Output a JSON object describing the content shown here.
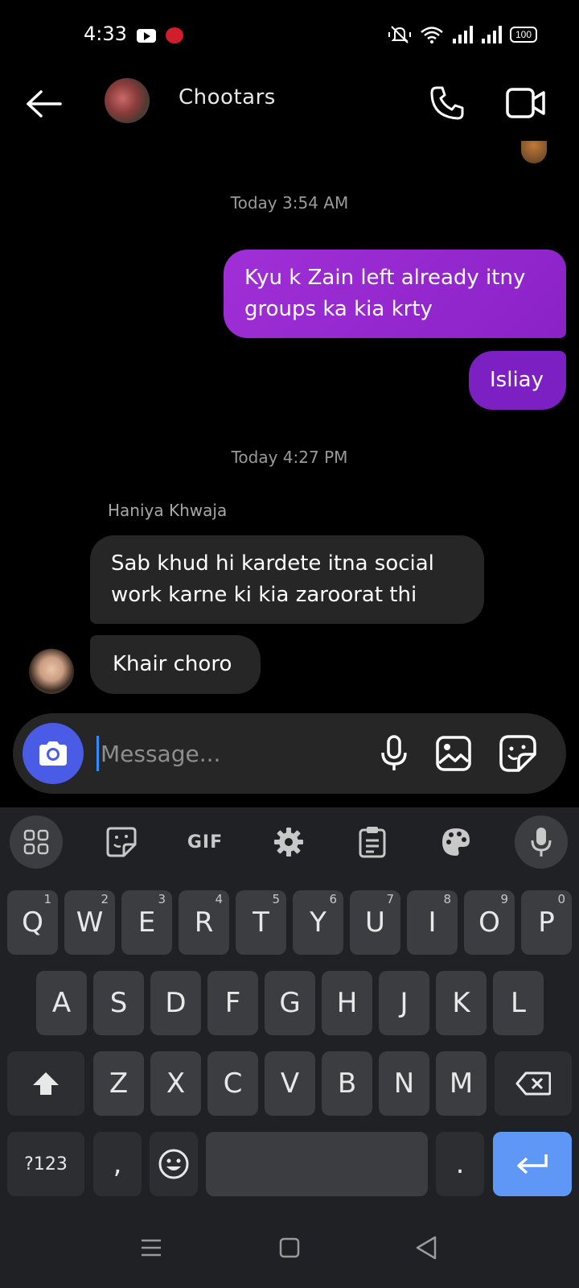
{
  "status_bar": {
    "time": "4:33",
    "battery": "100",
    "icons": [
      "youtube-icon",
      "app-notification-icon",
      "mute-icon",
      "wifi-icon",
      "signal-icon",
      "signal-icon-2",
      "battery-icon"
    ]
  },
  "header": {
    "group_name": "Chootars",
    "icons": [
      "back-arrow-icon",
      "phone-icon",
      "video-camera-icon"
    ]
  },
  "messages": {
    "timestamp_1": "Today 3:54 AM",
    "out_1": "Kyu k Zain left already itny groups ka kia krty",
    "out_2": "Isliay",
    "timestamp_2": "Today 4:27 PM",
    "sender_name": "Haniya Khwaja",
    "in_1": "Sab khud hi kardete itna social work karne ki kia zaroorat thi",
    "in_2": "Khair choro"
  },
  "composer": {
    "placeholder": "Message...",
    "icons": [
      "camera-icon",
      "microphone-icon",
      "gallery-icon",
      "sticker-icon"
    ],
    "accent": "#4a5ce6"
  },
  "keyboard": {
    "toolbar": {
      "gif": "GIF",
      "icons": [
        "apps-grid-icon",
        "sticker-icon",
        "settings-icon",
        "clipboard-icon",
        "palette-icon",
        "voice-input-icon"
      ]
    },
    "row1": [
      {
        "k": "Q",
        "h": "1"
      },
      {
        "k": "W",
        "h": "2"
      },
      {
        "k": "E",
        "h": "3"
      },
      {
        "k": "R",
        "h": "4"
      },
      {
        "k": "T",
        "h": "5"
      },
      {
        "k": "Y",
        "h": "6"
      },
      {
        "k": "U",
        "h": "7"
      },
      {
        "k": "I",
        "h": "8"
      },
      {
        "k": "O",
        "h": "9"
      },
      {
        "k": "P",
        "h": "0"
      }
    ],
    "row2": [
      "A",
      "S",
      "D",
      "F",
      "G",
      "H",
      "J",
      "K",
      "L"
    ],
    "row3": [
      "Z",
      "X",
      "C",
      "V",
      "B",
      "N",
      "M"
    ],
    "symbols": "?123",
    "comma": ",",
    "period": ".",
    "enter_color": "#5e97f6"
  },
  "nav": {
    "icons": [
      "recents-icon",
      "home-icon",
      "back-icon"
    ]
  }
}
